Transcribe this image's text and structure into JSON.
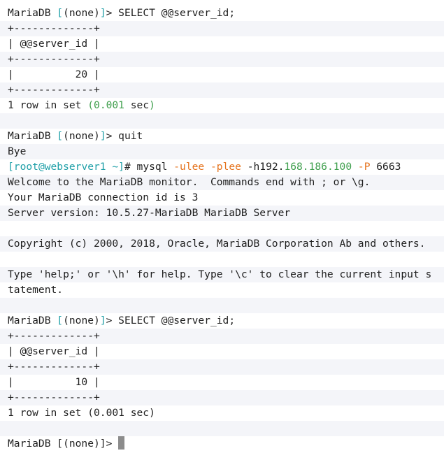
{
  "terminal": {
    "colors": {
      "default": "#1f1f1f",
      "teal": "#20a0a8",
      "orange": "#e5731d",
      "green": "#3f9f4d",
      "stripe": "#f4f5f9",
      "cursor": "#8c8c8c"
    },
    "lines": [
      [
        {
          "t": "MariaDB "
        },
        {
          "t": "[",
          "c": "teal"
        },
        {
          "t": "(none)"
        },
        {
          "t": "]",
          "c": "teal"
        },
        {
          "t": "> SELECT @@server_id;"
        }
      ],
      [
        {
          "t": "+-------------+"
        }
      ],
      [
        {
          "t": "| @@server_id |"
        }
      ],
      [
        {
          "t": "+-------------+"
        }
      ],
      [
        {
          "t": "|          20 |"
        }
      ],
      [
        {
          "t": "+-------------+"
        }
      ],
      [
        {
          "t": "1 row in set "
        },
        {
          "t": "(",
          "c": "green"
        },
        {
          "t": "0.001",
          "c": "green"
        },
        {
          "t": " sec"
        },
        {
          "t": ")",
          "c": "green"
        }
      ],
      [
        {
          "t": ""
        }
      ],
      [
        {
          "t": "MariaDB "
        },
        {
          "t": "[",
          "c": "teal"
        },
        {
          "t": "(none)"
        },
        {
          "t": "]",
          "c": "teal"
        },
        {
          "t": "> quit"
        }
      ],
      [
        {
          "t": "Bye"
        }
      ],
      [
        {
          "t": "[",
          "c": "teal"
        },
        {
          "t": "root@webserver1 ~",
          "c": "teal"
        },
        {
          "t": "]",
          "c": "teal"
        },
        {
          "t": "# mysql "
        },
        {
          "t": "-ulee",
          "c": "orange"
        },
        {
          "t": " "
        },
        {
          "t": "-plee",
          "c": "orange"
        },
        {
          "t": " -h192."
        },
        {
          "t": "168.186.100",
          "c": "green"
        },
        {
          "t": " "
        },
        {
          "t": "-P",
          "c": "orange"
        },
        {
          "t": " 6663"
        }
      ],
      [
        {
          "t": "Welcome to the MariaDB monitor.  Commands end with ; or \\g."
        }
      ],
      [
        {
          "t": "Your MariaDB connection id is 3"
        }
      ],
      [
        {
          "t": "Server version: 10.5.27-MariaDB MariaDB Server"
        }
      ],
      [
        {
          "t": ""
        }
      ],
      [
        {
          "t": "Copyright (c) 2000, 2018, Oracle, MariaDB Corporation Ab and others."
        }
      ],
      [
        {
          "t": ""
        }
      ],
      [
        {
          "t": "Type 'help;' or '\\h' for help. Type '\\c' to clear the current input s"
        }
      ],
      [
        {
          "t": "tatement."
        }
      ],
      [
        {
          "t": ""
        }
      ],
      [
        {
          "t": "MariaDB "
        },
        {
          "t": "[",
          "c": "teal"
        },
        {
          "t": "(none)"
        },
        {
          "t": "]",
          "c": "teal"
        },
        {
          "t": "> SELECT @@server_id;"
        }
      ],
      [
        {
          "t": "+-------------+"
        }
      ],
      [
        {
          "t": "| @@server_id |"
        }
      ],
      [
        {
          "t": "+-------------+"
        }
      ],
      [
        {
          "t": "|          10 |"
        }
      ],
      [
        {
          "t": "+-------------+"
        }
      ],
      [
        {
          "t": "1 row in set (0.001 sec)"
        }
      ],
      [
        {
          "t": ""
        }
      ],
      [
        {
          "t": "MariaDB [(none)]> "
        },
        {
          "cursor": true
        }
      ]
    ]
  }
}
